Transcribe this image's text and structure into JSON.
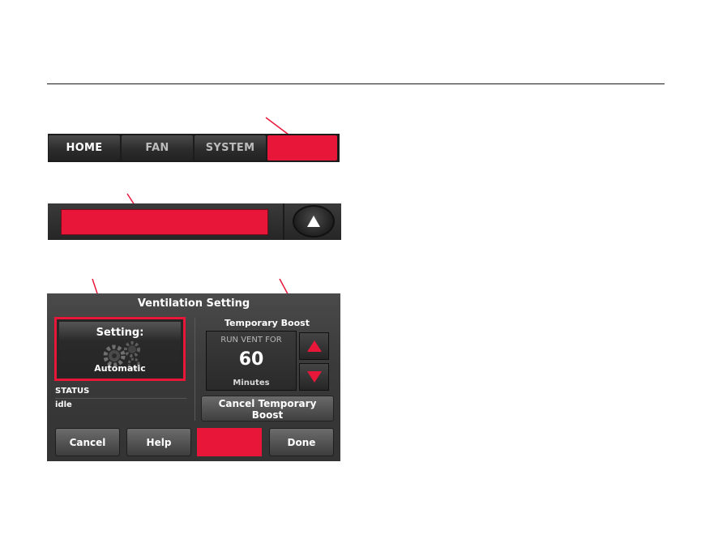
{
  "tabs": {
    "home": "HOME",
    "fan": "FAN",
    "system": "SYSTEM"
  },
  "panel": {
    "title": "Ventilation Setting",
    "setting_label": "Setting:",
    "setting_value": "Automatic",
    "status_label": "STATUS",
    "status_value": "idle",
    "boost_title": "Temporary Boost",
    "boost_caption": "RUN VENT FOR",
    "boost_value": "60",
    "boost_unit": "Minutes",
    "cancel_boost": "Cancel Temporary Boost"
  },
  "buttons": {
    "cancel": "Cancel",
    "help": "Help",
    "done": "Done"
  },
  "colors": {
    "highlight_red": "#e8173a",
    "panel_dark": "#333333"
  },
  "icons": [
    "gears-icon",
    "up-arrow-icon",
    "down-arrow-icon"
  ]
}
